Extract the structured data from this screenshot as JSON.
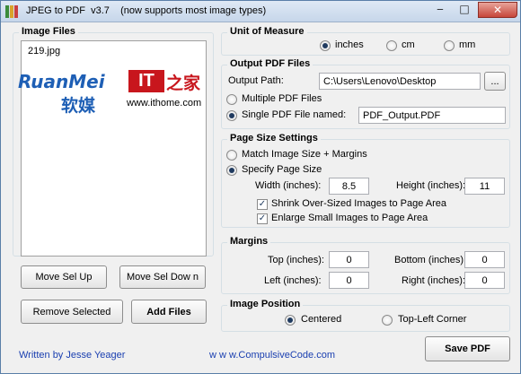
{
  "window": {
    "title": "JPEG to PDF  v3.7    (now supports most image types)",
    "minimize": "‒",
    "maximize": "□",
    "close": "✕"
  },
  "colors": {
    "accent": "#1a3fb0",
    "title_bg": "#c6d6ea",
    "close_bg": "#c7463a"
  },
  "image_files": {
    "heading": "Image Files",
    "items": [
      "219.jpg"
    ],
    "logo": {
      "brand1": "RuanMei",
      "brand1_cn": "软媒",
      "brand2": "IT",
      "brand2_cn": "之家",
      "url": "www.ithome.com"
    }
  },
  "buttons": {
    "move_up": "Move Sel Up",
    "move_down": "Move Sel Dow n",
    "remove": "Remove Selected",
    "add": "Add Files",
    "browse": "...",
    "save": "Save PDF"
  },
  "unit": {
    "heading": "Unit of Measure",
    "options": [
      "inches",
      "cm",
      "mm"
    ],
    "selected": "inches"
  },
  "output": {
    "heading": "Output PDF Files",
    "path_label": "Output Path:",
    "path_value": "C:\\Users\\Lenovo\\Desktop",
    "multiple_label": "Multiple PDF Files",
    "single_label": "Single PDF File named:",
    "single_value": "PDF_Output.PDF",
    "selected": "single"
  },
  "page_size": {
    "heading": "Page Size Settings",
    "match_label": "Match Image Size + Margins",
    "specify_label": "Specify Page Size",
    "selected": "specify",
    "width_label": "Width (inches):",
    "width_value": "8.5",
    "height_label": "Height (inches):",
    "height_value": "11",
    "shrink_label": "Shrink Over-Sized Images to Page Area",
    "shrink_checked": true,
    "enlarge_label": "Enlarge Small Images to Page Area",
    "enlarge_checked": true,
    "check_mark": "✓"
  },
  "margins": {
    "heading": "Margins",
    "top_label": "Top (inches):",
    "top_value": "0",
    "bottom_label": "Bottom (inches):",
    "bottom_value": "0",
    "left_label": "Left (inches):",
    "left_value": "0",
    "right_label": "Right (inches):",
    "right_value": "0"
  },
  "position": {
    "heading": "Image Position",
    "options": [
      "Centered",
      "Top-Left Corner"
    ],
    "selected": "Centered"
  },
  "footer": {
    "author": "Written by Jesse Yeager",
    "site": "w w w.CompulsiveCode.com"
  }
}
